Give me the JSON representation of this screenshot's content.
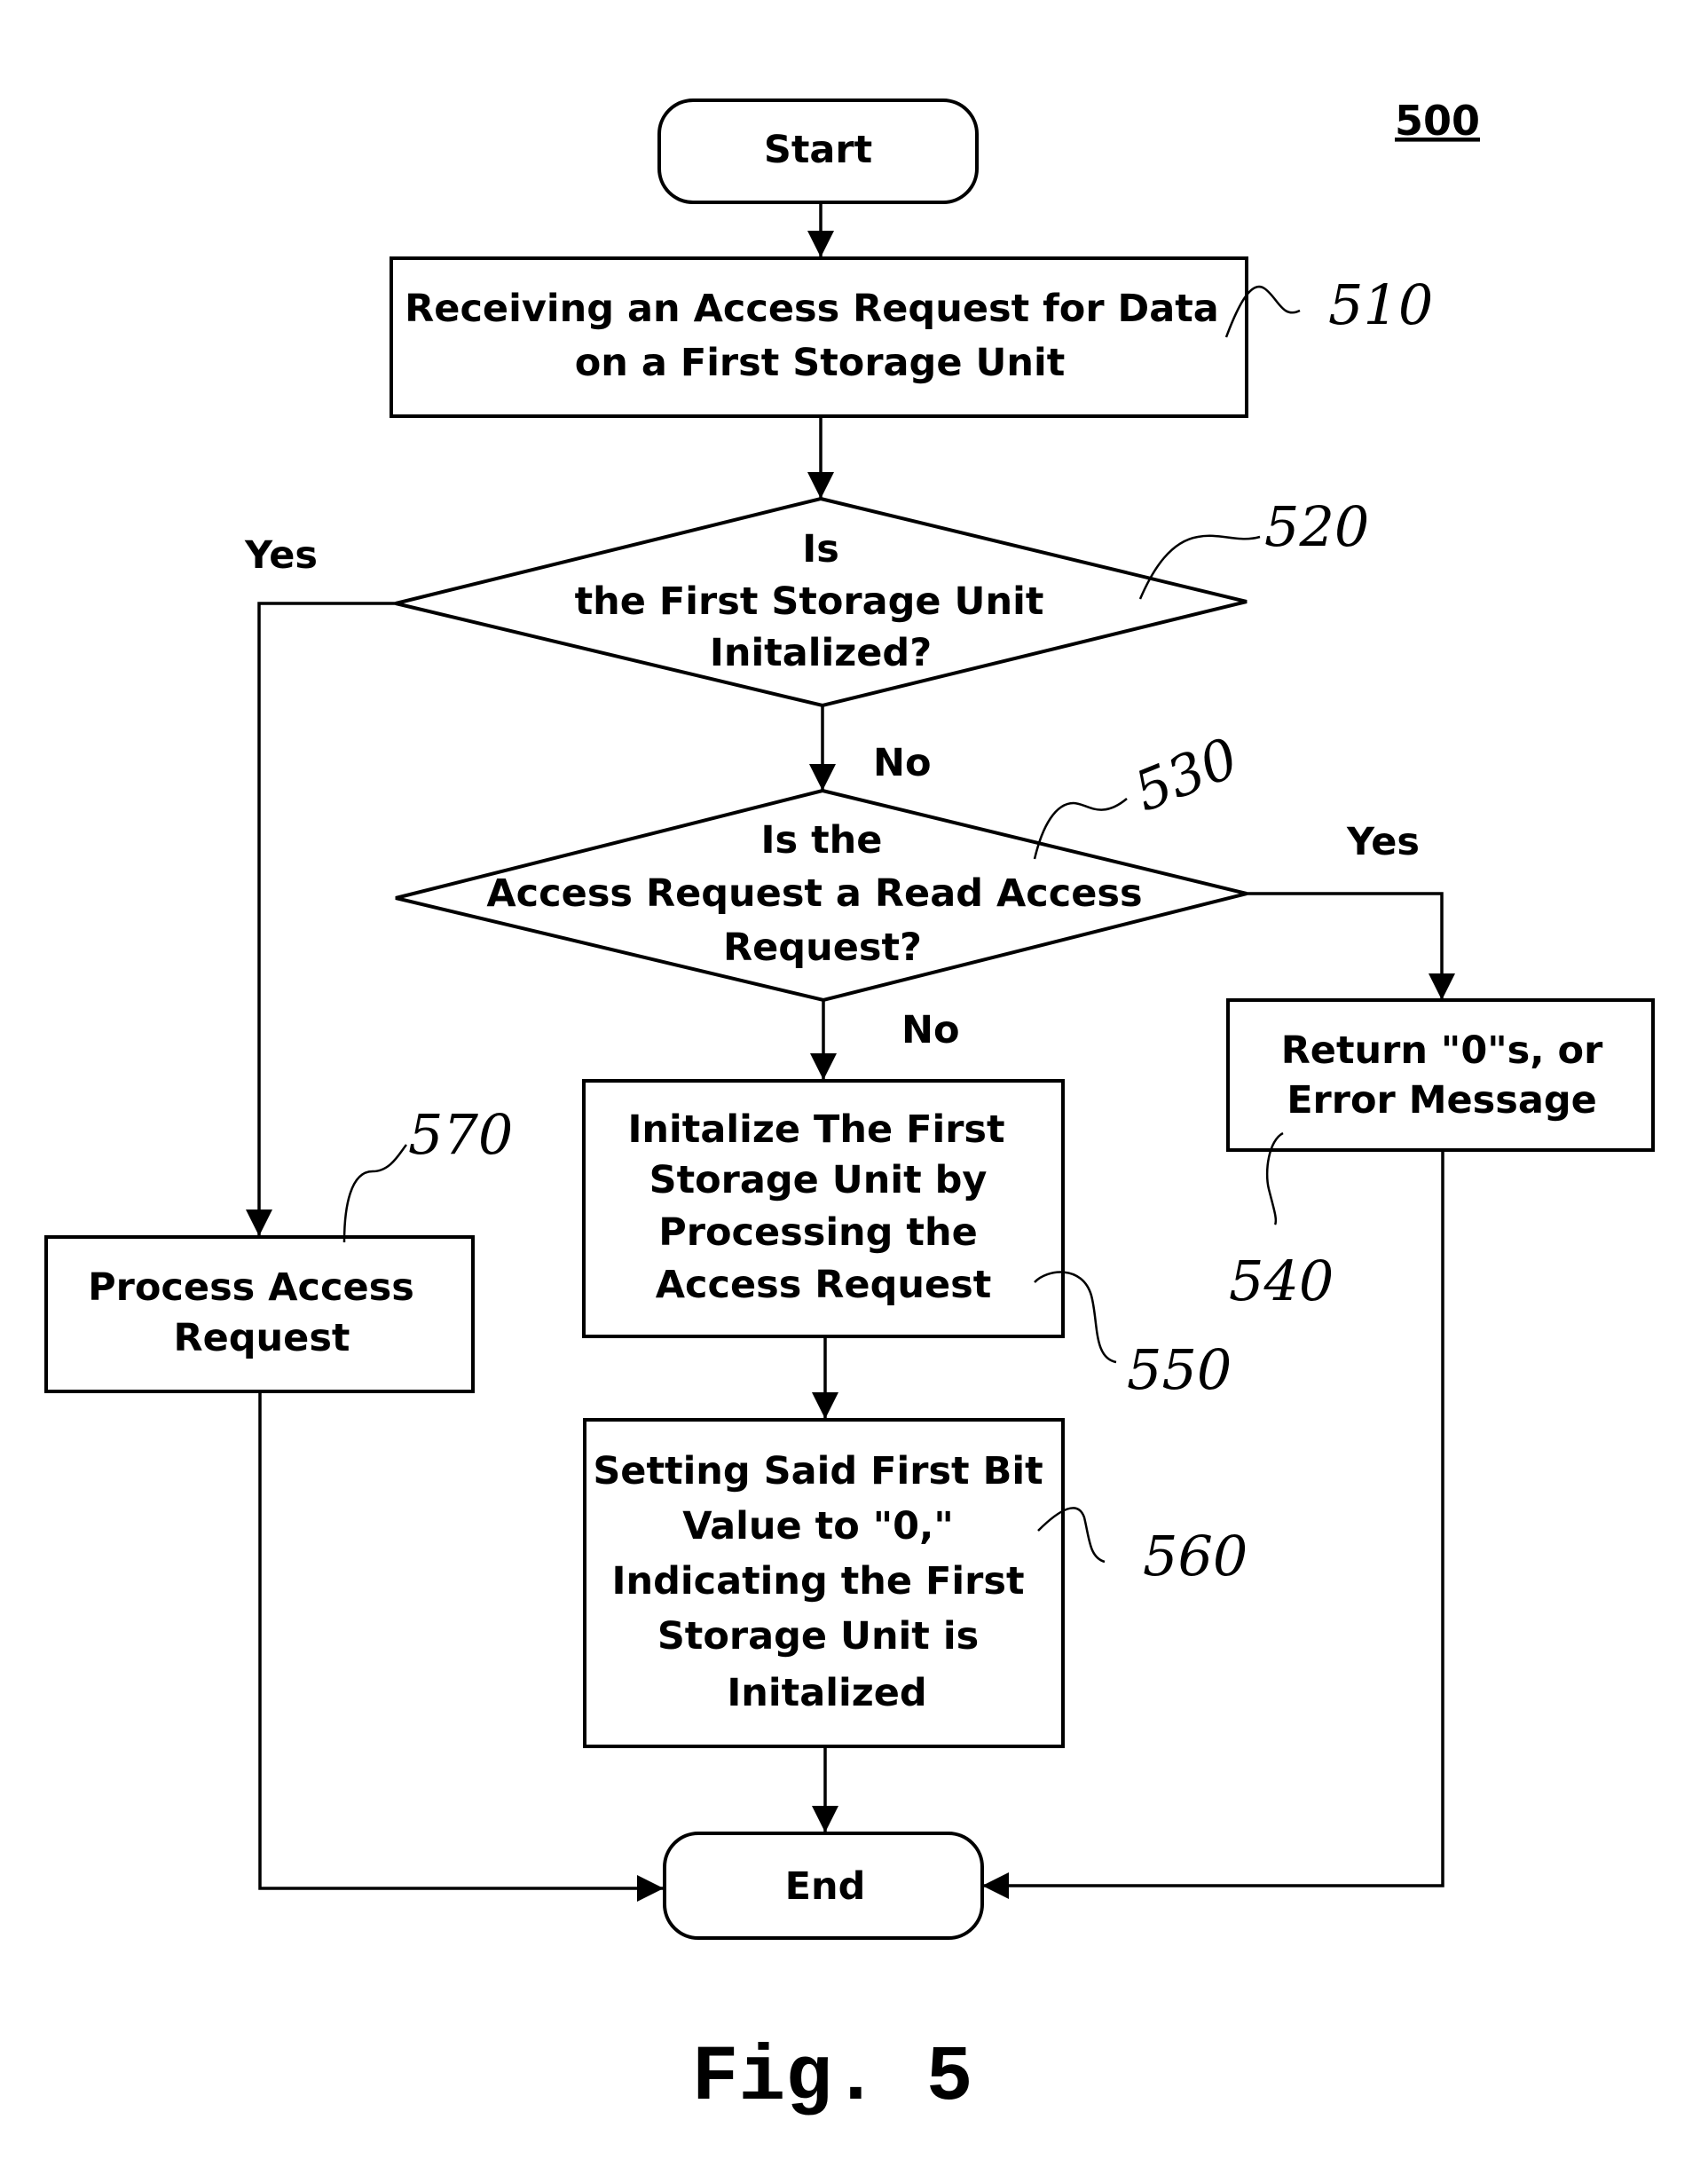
{
  "figure": {
    "reference_number": "500",
    "caption": "Fig. 5"
  },
  "nodes": {
    "start": {
      "type": "terminal",
      "lines": [
        "Start"
      ]
    },
    "n510": {
      "type": "process",
      "ref": "510",
      "lines": [
        "Receiving an Access Request for Data",
        "on a First Storage Unit"
      ]
    },
    "n520": {
      "type": "decision",
      "ref": "520",
      "lines": [
        "Is",
        "the First Storage Unit",
        "Initalized?"
      ]
    },
    "n530": {
      "type": "decision",
      "ref": "530",
      "lines": [
        "Is the",
        "Access Request a Read Access",
        "Request?"
      ]
    },
    "n540": {
      "type": "process",
      "ref": "540",
      "lines": [
        "Return \"0\"s, or",
        "Error Message"
      ]
    },
    "n550": {
      "type": "process",
      "ref": "550",
      "lines": [
        "Initalize The First",
        "Storage Unit by",
        "Processing the",
        "Access Request"
      ]
    },
    "n560": {
      "type": "process",
      "ref": "560",
      "lines": [
        "Setting Said First Bit",
        "Value to \"0,\"",
        "Indicating the First",
        "Storage Unit is",
        "Initalized"
      ]
    },
    "n570": {
      "type": "process",
      "ref": "570",
      "lines": [
        "Process Access",
        "Request"
      ]
    },
    "end": {
      "type": "terminal",
      "lines": [
        "End"
      ]
    }
  },
  "edges": [
    {
      "from": "start",
      "to": "n510",
      "label": ""
    },
    {
      "from": "n510",
      "to": "n520",
      "label": ""
    },
    {
      "from": "n520",
      "to": "n570",
      "label": "Yes"
    },
    {
      "from": "n520",
      "to": "n530",
      "label": "No"
    },
    {
      "from": "n530",
      "to": "n540",
      "label": "Yes"
    },
    {
      "from": "n530",
      "to": "n550",
      "label": "No"
    },
    {
      "from": "n550",
      "to": "n560",
      "label": ""
    },
    {
      "from": "n560",
      "to": "end",
      "label": ""
    },
    {
      "from": "n570",
      "to": "end",
      "label": ""
    },
    {
      "from": "n540",
      "to": "end",
      "label": ""
    }
  ]
}
